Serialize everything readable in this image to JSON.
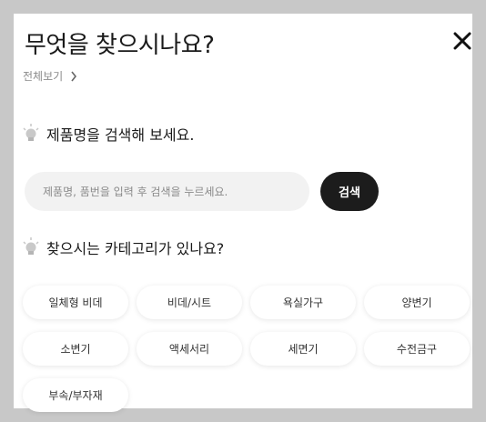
{
  "modal": {
    "title": "무엇을 찾으시나요?",
    "close_icon": "close-icon",
    "view_all_label": "전체보기"
  },
  "search": {
    "heading": "제품명을 검색해 보세요.",
    "placeholder": "제품명, 품번을 입력 후 검색을 누르세요.",
    "button_label": "검색"
  },
  "categories": {
    "heading": "찾으시는 카테고리가 있나요?",
    "items": [
      {
        "label": "일체형 비데"
      },
      {
        "label": "비데/시트"
      },
      {
        "label": "욕실가구"
      },
      {
        "label": "양변기"
      },
      {
        "label": "소변기"
      },
      {
        "label": "액세서리"
      },
      {
        "label": "세면기"
      },
      {
        "label": "수전금구"
      },
      {
        "label": "부속/부자재"
      }
    ]
  },
  "colors": {
    "backdrop": "#c8c8c8",
    "panel": "#ffffff",
    "search_button": "#1c1c1c",
    "input_bg": "#f2f2f2"
  }
}
